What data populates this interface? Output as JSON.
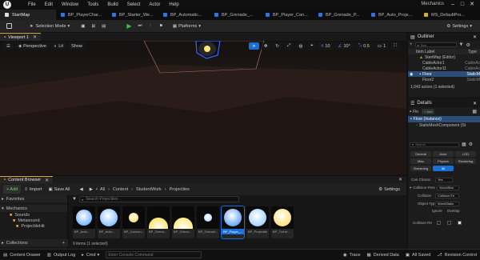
{
  "menu": [
    "File",
    "Edit",
    "Window",
    "Tools",
    "Build",
    "Select",
    "Actor",
    "Help"
  ],
  "app_title": "Mechanics",
  "tabs": [
    {
      "label": "StartMap",
      "color": "#e0e0e0",
      "active": true
    },
    {
      "label": "BP_PlayerChar...",
      "color": "#3a6fd8"
    },
    {
      "label": "BP_Starter_We...",
      "color": "#3a6fd8"
    },
    {
      "label": "BP_Automatic...",
      "color": "#3a6fd8"
    },
    {
      "label": "BP_Grenade_...",
      "color": "#3a6fd8"
    },
    {
      "label": "BP_Player_Can...",
      "color": "#3a6fd8"
    },
    {
      "label": "BP_Grenade_P...",
      "color": "#3a6fd8"
    },
    {
      "label": "BP_Auto_Proje...",
      "color": "#3a6fd8"
    },
    {
      "label": "MS_DefaultPro...",
      "color": "#d0b030"
    }
  ],
  "toolbar": {
    "selection_mode": "Selection Mode",
    "platforms": "Platforms",
    "settings": "Settings"
  },
  "viewport": {
    "tab_label": "Viewport 1",
    "perspective": "Perspective",
    "lit": "Lit",
    "show": "Show",
    "grid_snap": "10",
    "rot_snap": "10°",
    "scale_snap": "0.5",
    "cam_speed": "1"
  },
  "content_browser": {
    "title": "Content Browser",
    "add": "+ Add",
    "import": "Import",
    "save_all": "Save All",
    "breadcrumb": [
      "All",
      "Content",
      "StudentWork",
      "Projectiles"
    ],
    "settings": "Settings",
    "search_placeholder": "Search Projectiles",
    "favorites": "Favorites",
    "project": "Mechanics",
    "tree": [
      "Sounds",
      "Metasound",
      "ProjectileHit"
    ],
    "collections": "Collections",
    "status": "9 items (1 selected)",
    "assets": [
      {
        "label": "BP_Auto...",
        "orb": "#7ab8ff"
      },
      {
        "label": "BP_Auto...",
        "orb": "#8cc4ff"
      },
      {
        "label": "BP_Cannon...",
        "orb": "#ffe46a"
      },
      {
        "label": "BP_Grena...",
        "orb": "#ffe56f"
      },
      {
        "label": "BP_Grena...",
        "orb": "#ffeb8a"
      },
      {
        "label": "BP_Grenad...",
        "orb": "#bfe0ff"
      },
      {
        "label": "BP_Player_...",
        "orb": "#6aa9ff",
        "selected": true
      },
      {
        "label": "BP_Projectile",
        "orb": "#a8d4ff"
      },
      {
        "label": "BP_Turret...",
        "orb": "#ffe27a"
      }
    ]
  },
  "statusbar": {
    "content_drawer": "Content Drawer",
    "output_log": "Output Log",
    "cmd": "Cmd",
    "console_placeholder": "Enter Console Command",
    "trace": "Trace",
    "derived_data": "Derived Data",
    "all_saved": "All Saved",
    "revision_control": "Revision Control"
  },
  "outliner": {
    "title": "Outliner",
    "search_placeholder": "Sea",
    "col_label": "Item Label",
    "col_type": "Type",
    "rows": [
      {
        "label": "StartMap (Editor)",
        "type": ""
      },
      {
        "label": "CableActor1",
        "type": "CableAc"
      },
      {
        "label": "CableActor11",
        "type": "CableAc"
      },
      {
        "label": "Floor",
        "type": "StaticM",
        "selected": true
      },
      {
        "label": "Floor2",
        "type": "StaticM"
      }
    ],
    "count": "1,043 actors (1 selected)"
  },
  "details": {
    "title": "Details",
    "actor_name": "Flo",
    "add": "+ Add",
    "root": "Floor (Instance)",
    "component": "StaticMeshComponent (St",
    "search_placeholder": "Search",
    "filters": [
      {
        "label": "General"
      },
      {
        "label": "Actor"
      },
      {
        "label": "LOD"
      },
      {
        "label": "Misc"
      },
      {
        "label": "Physics"
      },
      {
        "label": "Rendering"
      },
      {
        "label": "Streaming"
      },
      {
        "label": "All",
        "on": true
      }
    ],
    "fields": [
      {
        "label": "Can Charac.",
        "value": "Yes"
      },
      {
        "label": "Collision Pres",
        "value": "WorldStat"
      },
      {
        "label": "Collision",
        "value": "Collision En"
      },
      {
        "label": "Object Typ",
        "value": "WorldStatic"
      },
      {
        "label": "Collision Re",
        "value": ""
      }
    ],
    "col_ignore": "Ignore",
    "col_overlap": "Overlap"
  }
}
